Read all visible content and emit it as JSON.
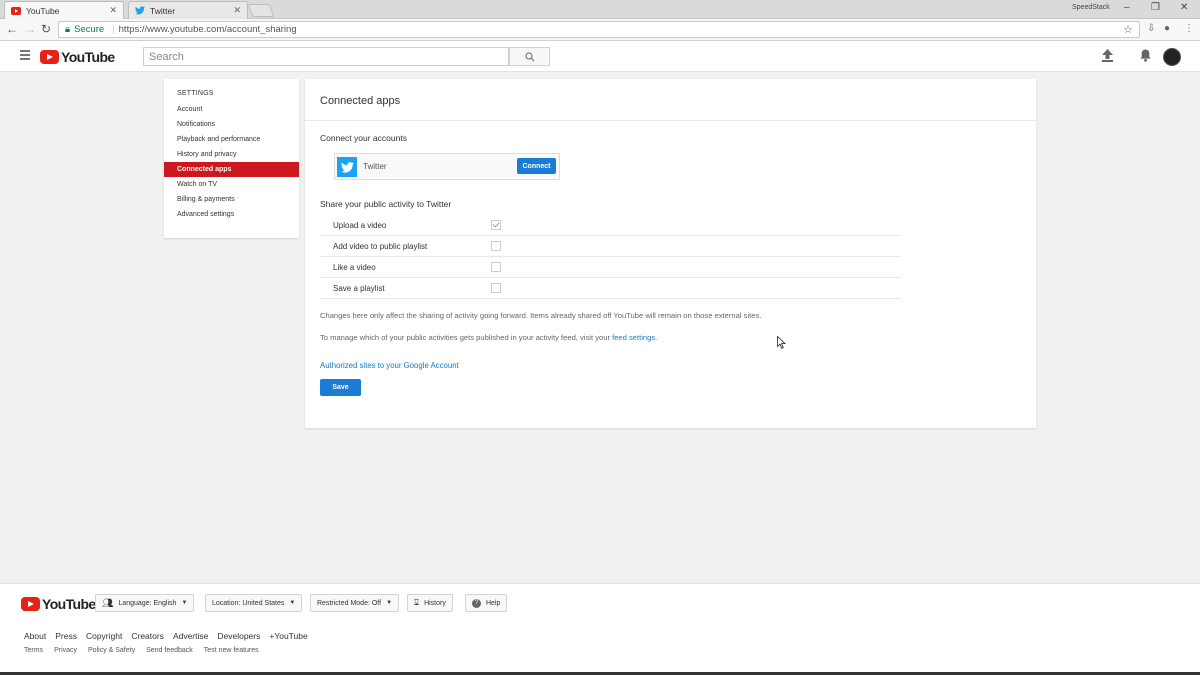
{
  "browser": {
    "tabs": [
      {
        "title": "YouTube",
        "favicon": "youtube-icon",
        "active": true
      },
      {
        "title": "Twitter",
        "favicon": "twitter-icon",
        "active": false
      }
    ],
    "window_label": "SpeedStack",
    "secure_label": "Secure",
    "url": "https://www.youtube.com/account_sharing"
  },
  "header": {
    "logo_text": "YouTube",
    "search_placeholder": "Search"
  },
  "sidebar": {
    "heading": "SETTINGS",
    "items": [
      {
        "label": "Account"
      },
      {
        "label": "Notifications"
      },
      {
        "label": "Playback and performance"
      },
      {
        "label": "History and privacy"
      },
      {
        "label": "Connected apps",
        "selected": true
      },
      {
        "label": "Watch on TV"
      },
      {
        "label": "Billing & payments"
      },
      {
        "label": "Advanced settings"
      }
    ]
  },
  "main": {
    "title": "Connected apps",
    "connect_heading": "Connect your accounts",
    "account_name": "Twitter",
    "connect_button": "Connect",
    "share_heading": "Share your public activity to Twitter",
    "activities": [
      {
        "label": "Upload a video",
        "checked": true
      },
      {
        "label": "Add video to public playlist",
        "checked": false
      },
      {
        "label": "Like a video",
        "checked": false
      },
      {
        "label": "Save a playlist",
        "checked": false
      }
    ],
    "note1": "Changes here only affect the sharing of activity going forward. Items already shared off YouTube will remain on those external sites.",
    "note2_prefix": "To manage which of your public activities gets published in your activity feed, visit your ",
    "note2_link": "feed settings",
    "note2_suffix": ".",
    "authorized_link": "Authorized sites to your Google Account",
    "save_button": "Save"
  },
  "footer": {
    "logo_text": "YouTube",
    "language": "Language: English",
    "location": "Location: United States",
    "restricted": "Restricted Mode: Off",
    "history": "History",
    "help": "Help",
    "links": [
      "About",
      "Press",
      "Copyright",
      "Creators",
      "Advertise",
      "Developers",
      "+YouTube"
    ],
    "sub_links": [
      "Terms",
      "Privacy",
      "Policy & Safety",
      "Send feedback",
      "Test new features"
    ]
  },
  "colors": {
    "accent_red": "#cc181e",
    "button_blue": "#1b7cd6",
    "link_blue": "#167ac6",
    "twitter_blue": "#1da1f2"
  }
}
